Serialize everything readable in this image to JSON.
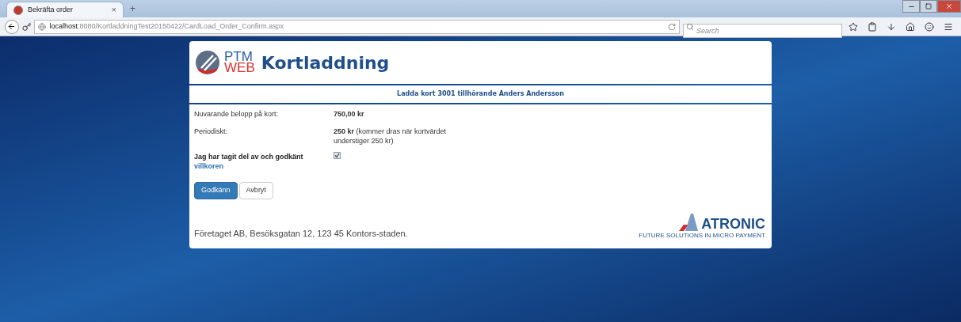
{
  "browser": {
    "tab_title": "Bekräfta order",
    "tab_close": "×",
    "new_tab": "+",
    "url_host": "localhost",
    "url_path": ":8080/KortladdningTest20150422/CardLoad_Order_Confirm.aspx",
    "search_placeholder": "Search"
  },
  "header": {
    "logo_top": "PTM",
    "logo_bottom": "WEB",
    "title": "Kortladdning"
  },
  "subtitle": "Ladda kort 3001 tillhörande Anders Andersson",
  "rows": [
    {
      "label": "Nuvarande belopp på kort:",
      "value": "**750,00 kr**"
    },
    {
      "label": "Periodiskt:",
      "value": "**250 kr** (kommer dras när kortvärdet understiger 250 kr)"
    }
  ],
  "terms": {
    "text": "Jag har tagit del av och godkänt",
    "link": "villkoren",
    "checked": true
  },
  "buttons": [
    {
      "label": "Godkänn",
      "kind": "primary"
    },
    {
      "label": "Avbryt",
      "kind": "default"
    }
  ],
  "footer": {
    "address": "Företaget AB, Besöksgatan 12, 123 45 Kontors-staden.",
    "brand": "ATRONIC",
    "tagline": "FUTURE SOLUTIONS IN MICRO PAYMENT"
  }
}
